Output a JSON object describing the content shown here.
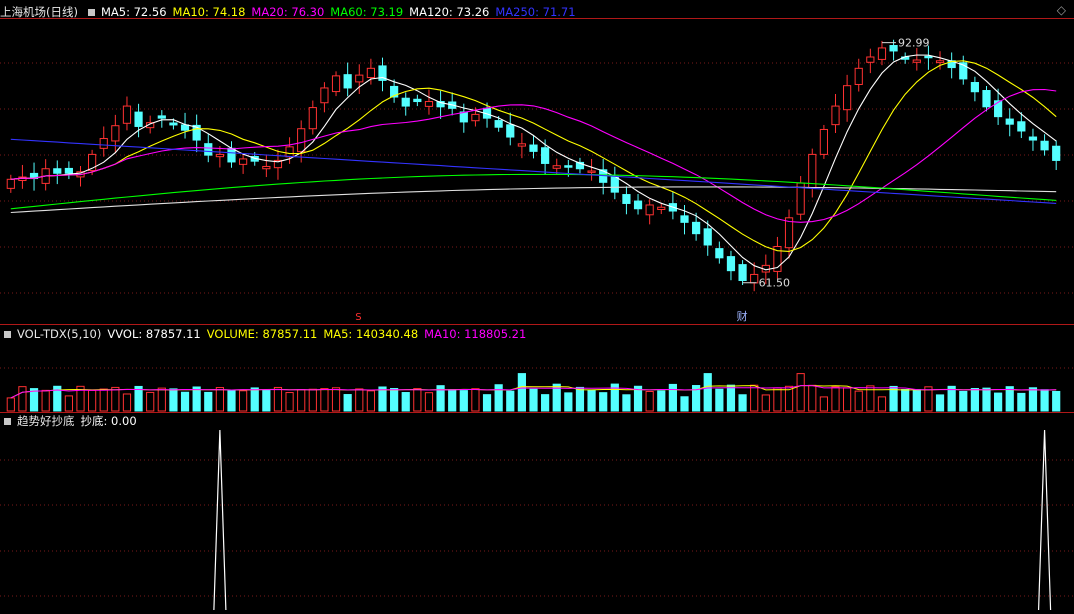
{
  "main_header": {
    "title": "上海机场(日线)",
    "items": [
      {
        "text": "MA5: 72.56",
        "color": "#ffffff"
      },
      {
        "text": "MA10: 74.18",
        "color": "#ffff00"
      },
      {
        "text": "MA20: 76.30",
        "color": "#ff00ff"
      },
      {
        "text": "MA60: 73.19",
        "color": "#00ff00"
      },
      {
        "text": "MA120: 73.26",
        "color": "#ffffff"
      },
      {
        "text": "MA250: 71.71",
        "color": "#3333ff"
      }
    ]
  },
  "vol_header": {
    "title": "VOL-TDX(5,10)",
    "items": [
      {
        "text": "VVOL: 87857.11",
        "color": "#ffffff"
      },
      {
        "text": "VOLUME: 87857.11",
        "color": "#ffff00"
      },
      {
        "text": "MA5: 140340.48",
        "color": "#ffff00"
      },
      {
        "text": "MA10: 118805.21",
        "color": "#ff00ff"
      }
    ]
  },
  "ind_header": {
    "title": "趋势好抄底",
    "items": [
      {
        "text": "抄底: 0.00",
        "color": "#ffffff"
      }
    ]
  },
  "annotations": {
    "high_label": "92.99",
    "low_label": "61.50",
    "cai_marker": "财",
    "s_marker": "S"
  },
  "colors": {
    "up": "#ff3232",
    "down": "#54ffff",
    "ma5": "#ffffff",
    "ma10": "#ffff00",
    "ma20": "#ff00ff",
    "ma60": "#00ff00",
    "ma120": "#e0e0e0",
    "ma250": "#3333ff",
    "grid": "#7a1a1a",
    "separator": "#b01818"
  },
  "chart_data": [
    {
      "type": "candlestick",
      "title": "上海机场(日线)",
      "series": [
        {
          "name": "MA5",
          "value": 72.56
        },
        {
          "name": "MA10",
          "value": 74.18
        },
        {
          "name": "MA20",
          "value": 76.3
        },
        {
          "name": "MA60",
          "value": 73.19
        },
        {
          "name": "MA120",
          "value": 73.26
        },
        {
          "name": "MA250",
          "value": 71.71
        }
      ],
      "annotations": [
        {
          "label": "92.99",
          "note": "high"
        },
        {
          "label": "61.50",
          "note": "low"
        }
      ],
      "close_trend": [
        74.9,
        75.2,
        75.0,
        76.3,
        75.7,
        75.7,
        75.9,
        78.2,
        80.3,
        82.0,
        84.6,
        81.9,
        82.4,
        83.0,
        82.1,
        81.4,
        80.1,
        78.1,
        78.2,
        77.2,
        77.6,
        77.3,
        76.6,
        77.4,
        79.2,
        81.6,
        84.4,
        87.0,
        88.6,
        87.0,
        88.7,
        89.6,
        88.0,
        85.8,
        84.6,
        85.2,
        85.2,
        84.5,
        84.3,
        82.5,
        83.5,
        83.0,
        81.8,
        80.5,
        79.6,
        78.6,
        77.0,
        76.7,
        76.5,
        76.3,
        76.0,
        74.5,
        73.2,
        71.7,
        71.0,
        71.5,
        71.2,
        70.7,
        69.2,
        67.7,
        66.2,
        64.5,
        62.8,
        61.5,
        62.3,
        63.5,
        66.0,
        69.8,
        74.4,
        78.2,
        81.5,
        84.6,
        87.3,
        89.6,
        91.1,
        92.3,
        91.9,
        90.8,
        90.7,
        91.0,
        90.6,
        89.7,
        88.2,
        86.5,
        84.5,
        83.2,
        82.2,
        81.3,
        80.1,
        78.8,
        77.4
      ]
    },
    {
      "type": "bar",
      "title": "VOL-TDX(5,10)",
      "series": [
        {
          "name": "VVOL",
          "value": 87857.11
        },
        {
          "name": "VOLUME",
          "value": 87857.11
        },
        {
          "name": "MA5",
          "value": 140340.48
        },
        {
          "name": "MA10",
          "value": 118805.21
        }
      ]
    },
    {
      "type": "line",
      "title": "趋势好抄底",
      "series": [
        {
          "name": "抄底",
          "value": 0.0
        }
      ]
    }
  ]
}
